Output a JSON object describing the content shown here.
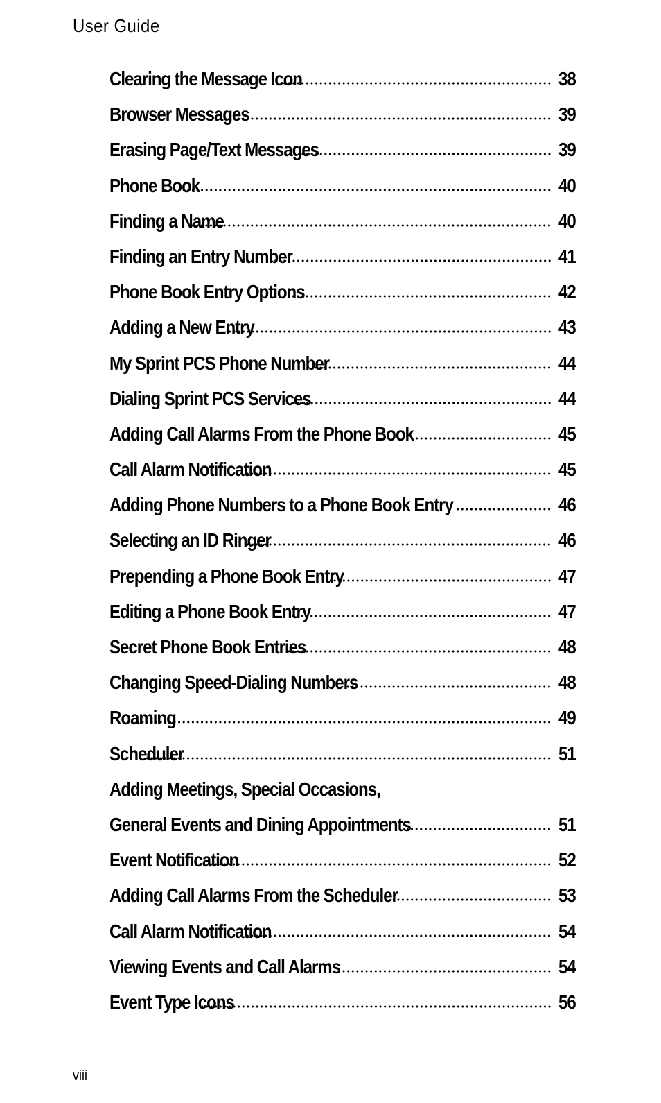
{
  "header": {
    "title": "User Guide"
  },
  "toc": [
    {
      "title": "Clearing the Message Icon",
      "page": "38"
    },
    {
      "title": "Browser Messages",
      "page": "39"
    },
    {
      "title": "Erasing Page/Text Messages",
      "page": "39"
    },
    {
      "title": "Phone Book",
      "page": "40"
    },
    {
      "title": "Finding a Name",
      "page": "40"
    },
    {
      "title": "Finding an Entry Number",
      "page": "41"
    },
    {
      "title": "Phone Book Entry Options",
      "page": "42"
    },
    {
      "title": "Adding a New Entry",
      "page": "43"
    },
    {
      "title": "My Sprint PCS Phone Number",
      "page": "44"
    },
    {
      "title": "Dialing Sprint PCS Services",
      "page": "44"
    },
    {
      "title": "Adding Call Alarms From the Phone Book",
      "page": "45"
    },
    {
      "title": "Call Alarm Notification",
      "page": "45"
    },
    {
      "title": "Adding Phone Numbers to a Phone Book Entry",
      "page": "46"
    },
    {
      "title": "Selecting an ID Ringer",
      "page": "46"
    },
    {
      "title": "Prepending a Phone Book Entry",
      "page": "47"
    },
    {
      "title": "Editing a Phone Book Entry",
      "page": "47"
    },
    {
      "title": "Secret Phone Book Entries",
      "page": "48"
    },
    {
      "title": "Changing Speed-Dialing Numbers",
      "page": "48"
    },
    {
      "title": "Roaming",
      "page": "49"
    },
    {
      "title": "Scheduler",
      "page": "51"
    },
    {
      "title": "Adding Meetings, Special Occasions,",
      "page": ""
    },
    {
      "title": "General Events and Dining Appointments",
      "page": "51"
    },
    {
      "title": "Event Notification",
      "page": "52"
    },
    {
      "title": "Adding Call Alarms From the Scheduler",
      "page": "53"
    },
    {
      "title": "Call Alarm Notification",
      "page": "54"
    },
    {
      "title": "Viewing Events and Call Alarms",
      "page": "54"
    },
    {
      "title": "Event Type Icons",
      "page": "56"
    }
  ],
  "footer": {
    "page_number": "viii"
  }
}
